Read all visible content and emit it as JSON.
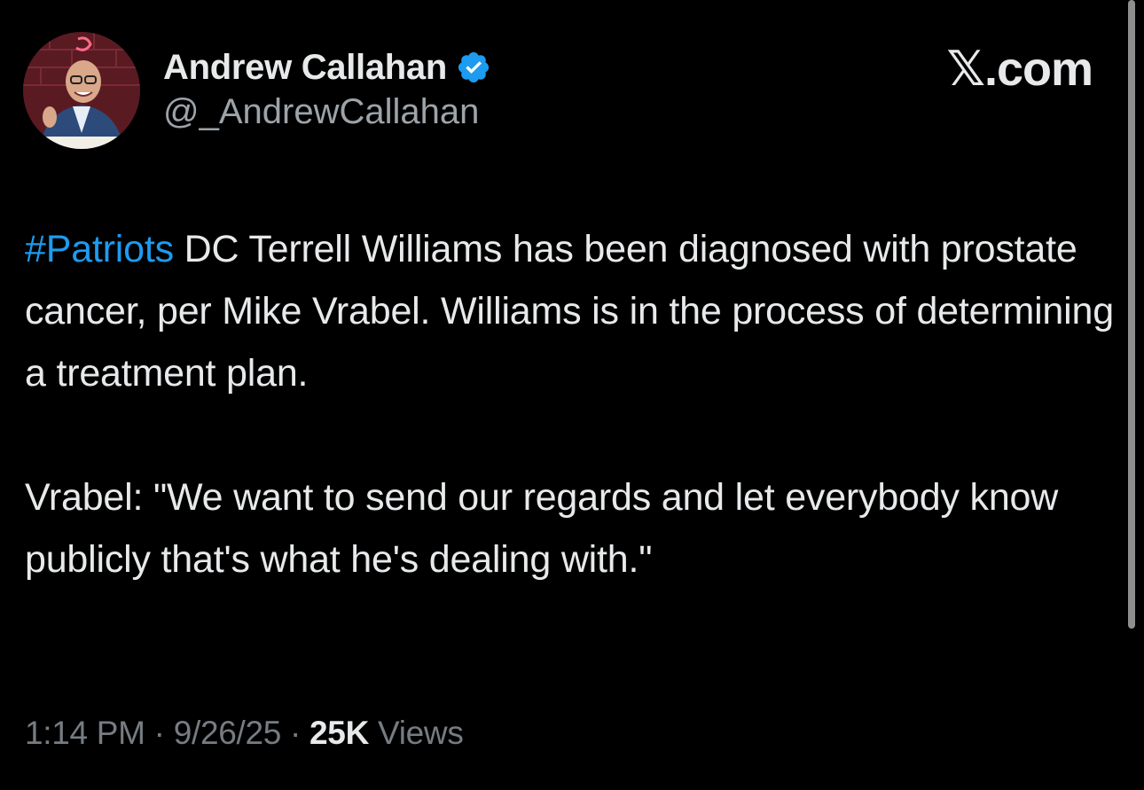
{
  "author": {
    "display_name": "Andrew Callahan",
    "handle": "@_AndrewCallahan",
    "verified_icon": "verified-badge-icon",
    "avatar_icon": "profile-avatar"
  },
  "brand": {
    "label": "𝕏.com"
  },
  "tweet": {
    "hashtag": "#Patriots",
    "paragraph1_rest": " DC Terrell Williams has been diagnosed with prostate cancer, per Mike Vrabel. Williams is in the process of determining a treatment plan.",
    "paragraph2": "Vrabel: \"We want to send our regards and let everybody know publicly that's what he's dealing with.\""
  },
  "meta": {
    "time": "1:14 PM",
    "separator": " · ",
    "date": "9/26/25",
    "views_count": "25K",
    "views_label": " Views"
  },
  "colors": {
    "background": "#000000",
    "text": "#e7e9ea",
    "secondary_text": "#767c82",
    "accent": "#1d9bf0"
  }
}
